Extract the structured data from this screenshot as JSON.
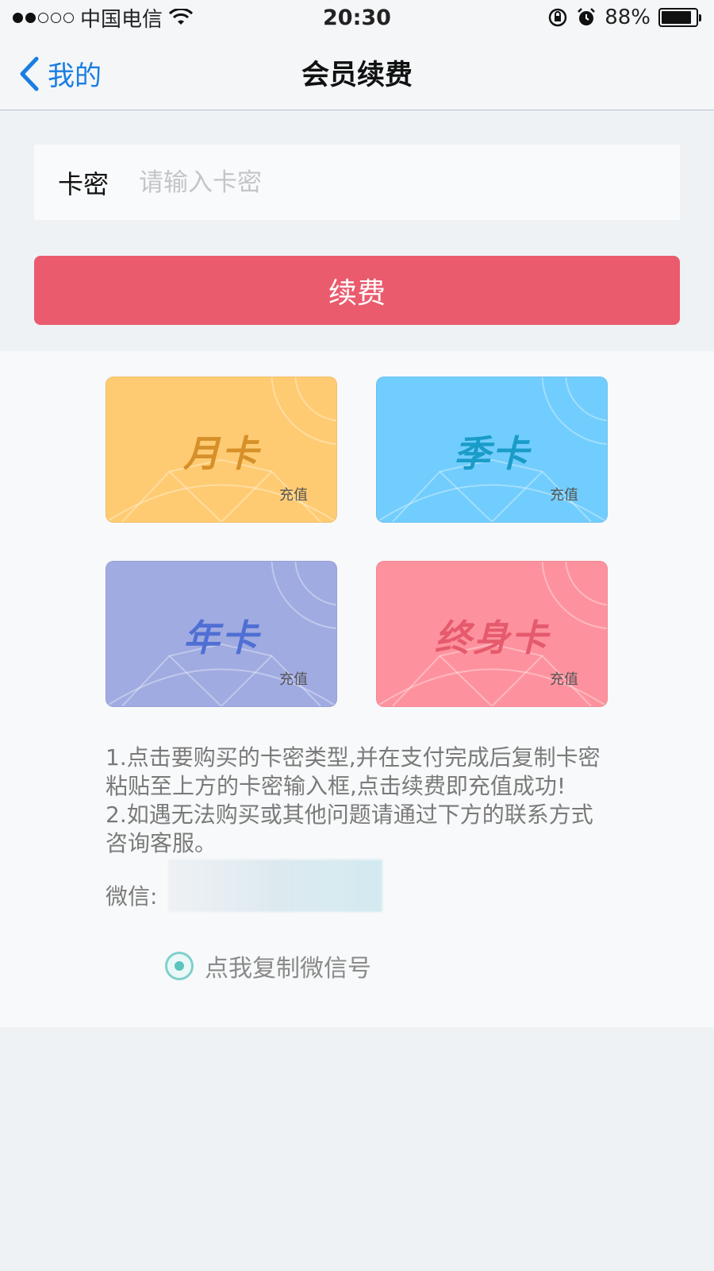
{
  "status_bar": {
    "carrier": "中国电信",
    "time": "20:30",
    "battery_percent_text": "88%",
    "battery_level": 0.88,
    "signal_bars_filled": 2,
    "signal_bars_total": 5
  },
  "nav": {
    "back_label": "我的",
    "title": "会员续费"
  },
  "form": {
    "label": "卡密",
    "input_value": "",
    "placeholder": "请输入卡密",
    "submit_label": "续费"
  },
  "cards": [
    {
      "title": "月卡",
      "subtitle": "充值",
      "color": "#ffcb72"
    },
    {
      "title": "季卡",
      "subtitle": "充值",
      "color": "#71cdfd"
    },
    {
      "title": "年卡",
      "subtitle": "充值",
      "color": "#a0abe1"
    },
    {
      "title": "终身卡",
      "subtitle": "充值",
      "color": "#fd929e"
    }
  ],
  "notes": {
    "line1": "1.点击要购买的卡密类型,并在支付完成后复制卡密粘贴至上方的卡密输入框,点击续费即充值成功!",
    "line2": "2.如遇无法购买或其他问题请通过下方的联系方式咨询客服。"
  },
  "contact": {
    "wechat_label": "微信:",
    "copy_label": "点我复制微信号"
  },
  "colors": {
    "accent": "#1a7de1",
    "button": "#ea5b6e",
    "radio": "#5cc4bf"
  }
}
